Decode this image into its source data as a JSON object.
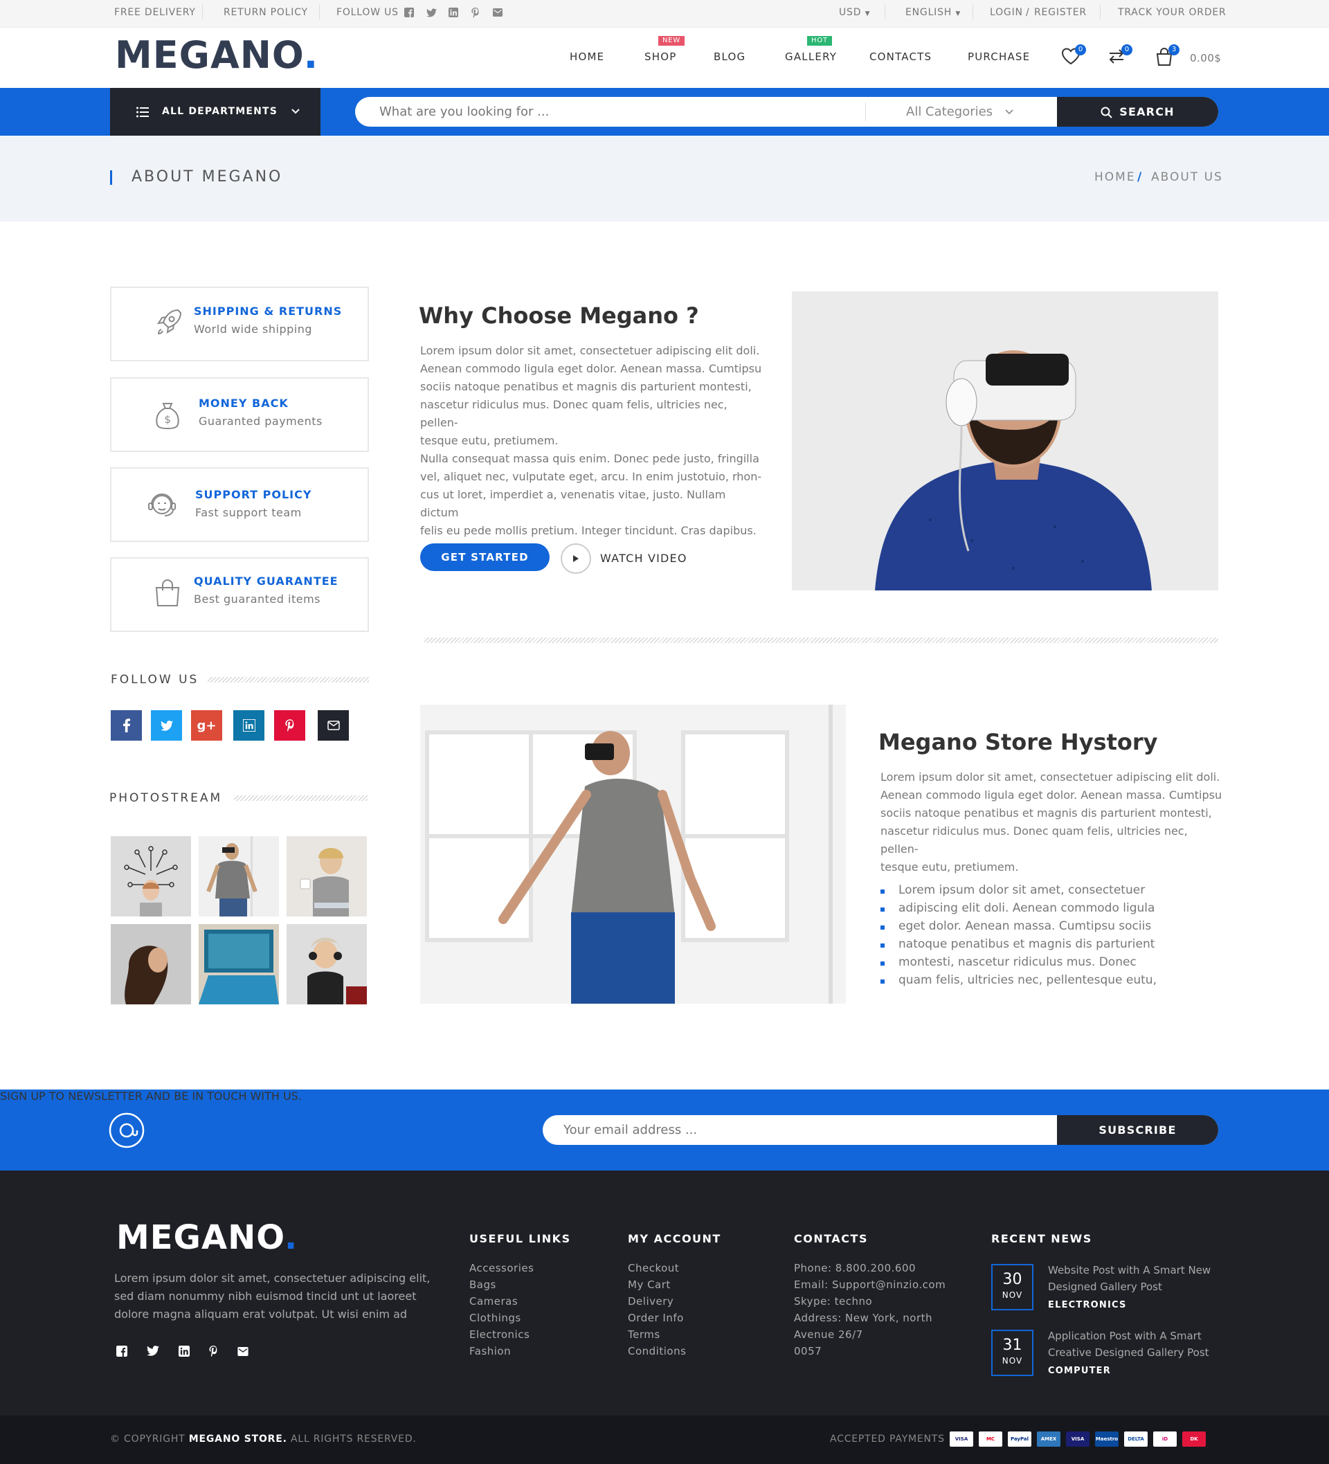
{
  "topbar": {
    "free_delivery": "FREE DELIVERY",
    "return_policy": "RETURN POLICY",
    "follow_us": "FOLLOW US",
    "currency": "USD",
    "language": "ENGLISH",
    "login": "LOGIN",
    "login_sep": "/",
    "register": "REGISTER",
    "track": "TRACK YOUR ORDER",
    "icons": [
      "facebook-icon",
      "twitter-icon",
      "linkedin-icon",
      "pinterest-icon",
      "mail-icon"
    ]
  },
  "header": {
    "logo_main": "MEGANO",
    "logo_dot": ".",
    "nav": [
      {
        "label": "HOME"
      },
      {
        "label": "SHOP",
        "badge": "NEW",
        "badge_color": "#e8556a"
      },
      {
        "label": "BLOG"
      },
      {
        "label": "GALLERY",
        "badge": "HOT",
        "badge_color": "#2bb673"
      },
      {
        "label": "CONTACTS"
      },
      {
        "label": "PURCHASE"
      }
    ],
    "wishlist_count": "0",
    "compare_count": "0",
    "cart_count": "3",
    "cart_total": "0.00$"
  },
  "searchbar": {
    "departments": "ALL DEPARTMENTS",
    "placeholder": "What are you looking for ...",
    "category": "All Categories",
    "button": "SEARCH"
  },
  "page_title": {
    "title": "ABOUT MEGANO",
    "breadcrumb_home": "HOME",
    "breadcrumb_sep": "/",
    "breadcrumb_current": "ABOUT US"
  },
  "features": [
    {
      "title": "SHIPPING & RETURNS",
      "subtitle": "World wide shipping",
      "icon": "rocket-icon"
    },
    {
      "title": "MONEY BACK",
      "subtitle": "Guaranted payments",
      "icon": "money-bag-icon"
    },
    {
      "title": "SUPPORT POLICY",
      "subtitle": "Fast support team",
      "icon": "support-agent-icon"
    },
    {
      "title": "QUALITY GUARANTEE",
      "subtitle": "Best guaranted items",
      "icon": "shopping-bag-icon"
    }
  ],
  "sidebar": {
    "follow_heading": "FOLLOW US",
    "social": [
      {
        "icon": "facebook-icon",
        "color": "#3b5998"
      },
      {
        "icon": "twitter-icon",
        "color": "#1da1f2"
      },
      {
        "icon": "google-plus-icon",
        "color": "#dd4b39"
      },
      {
        "icon": "linkedin-icon",
        "color": "#0e76a8"
      },
      {
        "icon": "pinterest-icon",
        "color": "#e0103a"
      },
      {
        "icon": "mail-icon",
        "color": "#22252d"
      }
    ],
    "photostream_heading": "PHOTOSTREAM"
  },
  "why": {
    "title": "Why Choose Megano ?",
    "para1_lines": [
      "Lorem ipsum dolor sit amet, consectetuer adipiscing elit doli.",
      "Aenean commodo ligula eget dolor. Aenean massa. Cumtipsu",
      "sociis natoque penatibus et magnis dis parturient montesti,",
      "nascetur ridiculus mus. Donec quam felis, ultricies nec, pellen-",
      "tesque eutu, pretiumem."
    ],
    "para2_lines": [
      "Nulla consequat massa quis enim. Donec pede justo, fringilla",
      "vel, aliquet nec, vulputate eget, arcu. In enim justotuio, rhon-",
      "cus ut loret, imperdiet a, venenatis vitae, justo. Nullam dictum",
      "felis eu pede mollis pretium. Integer tincidunt. Cras dapibus."
    ],
    "cta": "GET STARTED",
    "watch": "WATCH VIDEO"
  },
  "history": {
    "title": "Megano Store Hystory",
    "para_lines": [
      "Lorem ipsum dolor sit amet, consectetuer adipiscing elit doli.",
      "Aenean commodo ligula eget dolor. Aenean massa. Cumtipsu",
      "sociis natoque penatibus et magnis dis parturient montesti,",
      "nascetur ridiculus mus. Donec quam felis, ultricies nec, pellen-",
      "tesque eutu, pretiumem."
    ],
    "bullets": [
      "Lorem ipsum dolor sit amet, consectetuer",
      "adipiscing elit doli. Aenean commodo ligula",
      "eget dolor. Aenean massa. Cumtipsu sociis",
      "natoque penatibus et magnis dis parturient",
      "montesti, nascetur ridiculus mus. Donec",
      "quam felis, ultricies nec, pellentesque eutu,"
    ]
  },
  "newsletter": {
    "text": "SIGN UP TO NEWSLETTER AND BE IN TOUCH WITH US.",
    "placeholder": "Your email address ...",
    "button": "SUBSCRIBE"
  },
  "footer": {
    "logo_main": "MEGANO",
    "logo_dot": ".",
    "about_lines": [
      "Lorem ipsum dolor sit amet, consectetuer adipiscing elit,",
      "sed diam nonummy nibh euismod tincid  unt ut laoreet",
      "dolore magna aliquam erat volutpat. Ut wisi enim ad"
    ],
    "useful_links": {
      "heading": "USEFUL LINKS",
      "items": [
        "Accessories",
        "Bags",
        "Cameras",
        "Clothings",
        "Electronics",
        "Fashion"
      ]
    },
    "my_account": {
      "heading": "MY ACCOUNT",
      "items": [
        "Checkout",
        "My Cart",
        "Delivery",
        "Order Info",
        "Terms",
        "Conditions"
      ]
    },
    "contacts": {
      "heading": "CONTACTS",
      "items": [
        "Phone: 8.800.200.600",
        "Email: Support@ninzio.com",
        "Skype: techno",
        "Address: New York, north",
        "Avenue 26/7",
        "0057"
      ]
    },
    "recent_news": {
      "heading": "RECENT NEWS",
      "posts": [
        {
          "day": "30",
          "month": "NOV",
          "title_lines": [
            "Website Post with A Smart New",
            "Designed Gallery Post"
          ],
          "category": "ELECTRONICS"
        },
        {
          "day": "31",
          "month": "NOV",
          "title_lines": [
            "Application Post with A Smart",
            "Creative Designed Gallery Post"
          ],
          "category": "COMPUTER"
        }
      ]
    },
    "copyright_prefix": "© COPYRIGHT",
    "copyright_brand": "MEGANO STORE.",
    "copyright_suffix": "ALL RIGHTS RESERVED.",
    "accepted": "ACCEPTED PAYMENTS",
    "payments": [
      {
        "label": "VISA",
        "color": "#ffffff",
        "text": "#1a1f71"
      },
      {
        "label": "MC",
        "color": "#ffffff",
        "text": "#eb001b"
      },
      {
        "label": "PayPal",
        "color": "#ffffff",
        "text": "#003087"
      },
      {
        "label": "AMEX",
        "color": "#2e77bb",
        "text": "#ffffff"
      },
      {
        "label": "VISA",
        "color": "#1a1f71",
        "text": "#ffffff"
      },
      {
        "label": "Maestro",
        "color": "#0a4a9c",
        "text": "#ffffff"
      },
      {
        "label": "DELTA",
        "color": "#ffffff",
        "text": "#0a4a9c"
      },
      {
        "label": "iD",
        "color": "#ffffff",
        "text": "#cc0066"
      },
      {
        "label": "DK",
        "color": "#e3173e",
        "text": "#ffffff"
      }
    ]
  },
  "colors": {
    "accent": "#1266d9",
    "dark": "#22252d",
    "footer": "#1f2026"
  }
}
